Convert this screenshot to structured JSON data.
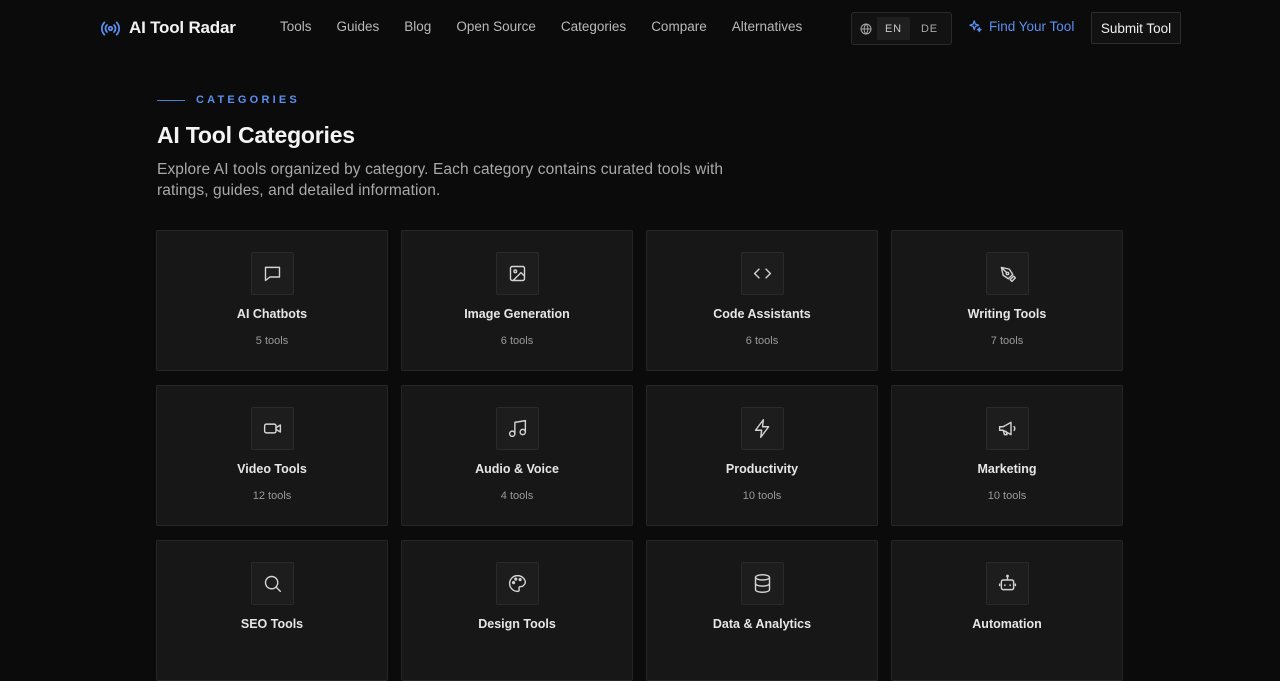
{
  "brand": {
    "name": "AI Tool Radar",
    "icon": "radar-icon",
    "accent": "#5b8ff0"
  },
  "nav": [
    "Tools",
    "Guides",
    "Blog",
    "Open Source",
    "Categories",
    "Compare",
    "Alternatives"
  ],
  "lang": {
    "icon": "globe-icon",
    "options": [
      "EN",
      "DE"
    ],
    "selected": "EN"
  },
  "find_tool": {
    "label": "Find Your Tool",
    "icon": "sparkles-icon"
  },
  "submit_tool": {
    "label": "Submit Tool"
  },
  "hero": {
    "eyebrow": "CATEGORIES",
    "title": "AI Tool Categories",
    "subtitle": "Explore AI tools organized by category. Each category contains curated tools with ratings, guides, and detailed information."
  },
  "categories": [
    {
      "name": "AI Chatbots",
      "count": "5 tools",
      "icon": "chat-icon"
    },
    {
      "name": "Image Generation",
      "count": "6 tools",
      "icon": "image-icon"
    },
    {
      "name": "Code Assistants",
      "count": "6 tools",
      "icon": "code-icon"
    },
    {
      "name": "Writing Tools",
      "count": "7 tools",
      "icon": "pen-icon"
    },
    {
      "name": "Video Tools",
      "count": "12 tools",
      "icon": "video-icon"
    },
    {
      "name": "Audio & Voice",
      "count": "4 tools",
      "icon": "music-icon"
    },
    {
      "name": "Productivity",
      "count": "10 tools",
      "icon": "zap-icon"
    },
    {
      "name": "Marketing",
      "count": "10 tools",
      "icon": "megaphone-icon"
    },
    {
      "name": "SEO Tools",
      "count": "",
      "icon": "search-icon"
    },
    {
      "name": "Design Tools",
      "count": "",
      "icon": "palette-icon"
    },
    {
      "name": "Data & Analytics",
      "count": "",
      "icon": "database-icon"
    },
    {
      "name": "Automation",
      "count": "",
      "icon": "bot-icon"
    }
  ]
}
